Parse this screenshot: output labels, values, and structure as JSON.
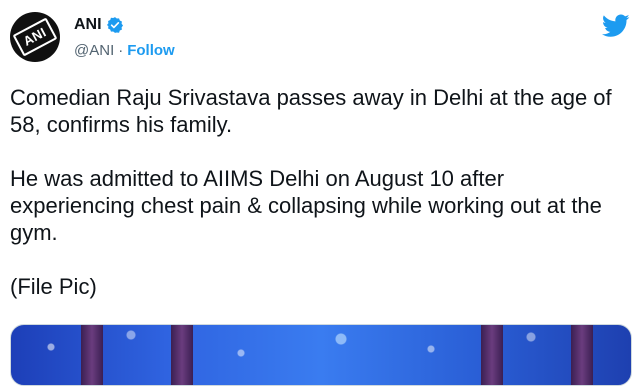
{
  "tweet": {
    "author": {
      "name": "ANI",
      "handle": "@ANI",
      "separator": "·",
      "follow_label": "Follow",
      "avatar_text": "ANI"
    },
    "paragraphs": [
      "Comedian Raju Srivastava passes away in Delhi at the age of 58, confirms his family.",
      "He was admitted to AIIMS Delhi on August 10 after experiencing chest pain & collapsing while working out at the gym.",
      "(File Pic)"
    ],
    "icons": {
      "verified": "verified-badge-icon",
      "brand": "twitter-bird-icon"
    },
    "colors": {
      "accent": "#1d9bf0",
      "text": "#0f1419",
      "secondary_text": "#536471"
    }
  }
}
